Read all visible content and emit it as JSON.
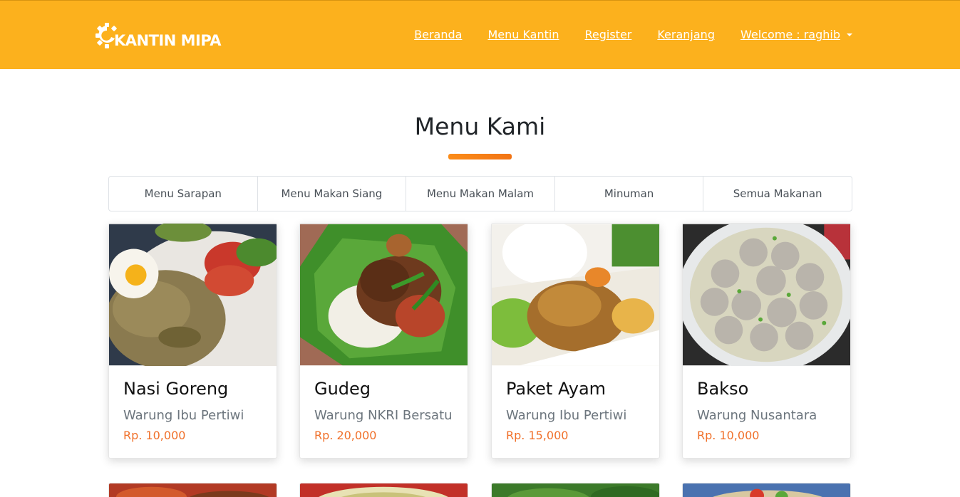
{
  "brand": {
    "name": "KANTIN MIPA"
  },
  "nav": {
    "links": [
      "Beranda",
      "Menu Kantin",
      "Register",
      "Keranjang"
    ],
    "welcome": "Welcome : raghib"
  },
  "section": {
    "title": "Menu Kami"
  },
  "tabs": [
    "Menu Sarapan",
    "Menu Makan Siang",
    "Menu Makan Malam",
    "Minuman",
    "Semua Makanan"
  ],
  "cards": [
    {
      "name": "Nasi Goreng",
      "shop": "Warung Ibu Pertiwi",
      "price": "Rp. 10,000"
    },
    {
      "name": "Gudeg",
      "shop": "Warung NKRI Bersatu",
      "price": "Rp. 20,000"
    },
    {
      "name": "Paket Ayam",
      "shop": "Warung Ibu Pertiwi",
      "price": "Rp. 15,000"
    },
    {
      "name": "Bakso",
      "shop": "Warung Nusantara",
      "price": "Rp. 10,000"
    }
  ],
  "colors": {
    "navbar": "#fcb11d",
    "accent": "#f0702a",
    "underline": "#fb8c19"
  }
}
